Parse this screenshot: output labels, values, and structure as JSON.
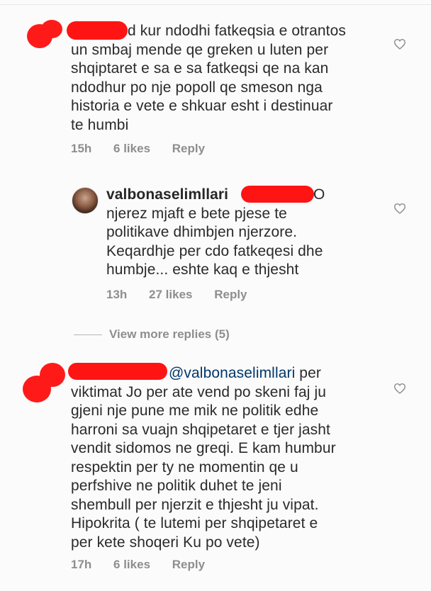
{
  "comments": [
    {
      "lines": [
        "d kur ndodhi fatkeqsia e otrantos",
        "un smbaj mende qe greken u luten per",
        "shqiptaret e sa e sa fatkeqsi qe na kan",
        "ndodhur po nje popoll qe smeson nga",
        "historia e vete e shkuar esht i destinuar",
        "te humbi"
      ],
      "time": "15h",
      "likes": "6 likes",
      "reply": "Reply"
    },
    {
      "username": "valbonaselimllari",
      "after_redact": "O",
      "lines": [
        "njerez mjaft e bete pjese te",
        "politikave dhimbjen njerzore.",
        "Keqardhje per cdo fatkeqesi dhe",
        "humbje... eshte kaq e thjesht"
      ],
      "time": "13h",
      "likes": "27 likes",
      "reply": "Reply"
    },
    {
      "mention": "@valbonaselimllari",
      "first_tail": " per",
      "lines": [
        "viktimat Jo per ate vend po skeni faj ju",
        "gjeni nje pune me mik ne politik edhe",
        "harroni sa vuajn shqipetaret e tjer jasht",
        "vendit sidomos ne greqi. E kam humbur",
        "respektin per ty ne momentin qe u",
        "perfshive ne politik duhet te jeni",
        "shembull per njerzit e thjesht ju vipat.",
        "Hipokrita ( te lutemi per shqipetaret e",
        "per kete shoqeri Ku po vete)"
      ],
      "time": "17h",
      "likes": "6 likes",
      "reply": "Reply"
    }
  ],
  "view_more": "View more replies (5)",
  "colors": {
    "redaction": "#ff1414",
    "meta": "#8e8e8e",
    "mention": "#00376b"
  }
}
